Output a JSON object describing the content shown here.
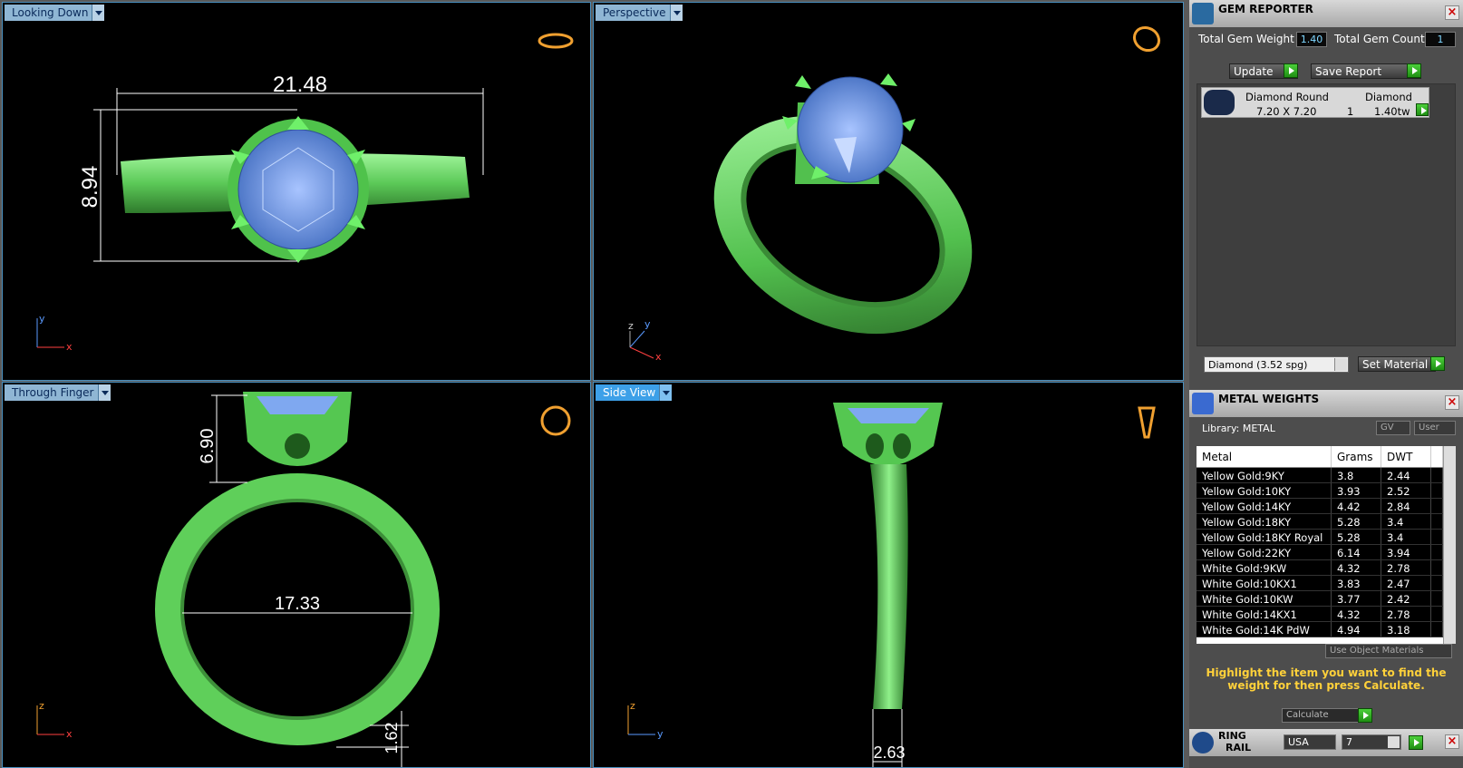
{
  "viewports": {
    "top_left": {
      "label": "Looking Down",
      "dim_width": "21.48",
      "dim_height": "8.94",
      "axis_a": "y",
      "axis_b": "x"
    },
    "top_right": {
      "label": "Perspective",
      "axis_a": "z",
      "axis_b": "y",
      "axis_c": "x"
    },
    "bottom_left": {
      "label": "Through Finger",
      "dim_height": "6.90",
      "dim_inner": "17.33",
      "dim_shank": "1.62",
      "axis_a": "z",
      "axis_b": "x"
    },
    "bottom_right": {
      "label": "Side View",
      "dim_width": "2.63",
      "axis_a": "z",
      "axis_b": "y"
    }
  },
  "gem_reporter": {
    "title": "GEM REPORTER",
    "total_weight_label": "Total Gem Weight",
    "total_weight_value": "1.40",
    "total_count_label": "Total Gem Count",
    "total_count_value": "1",
    "update_label": "Update",
    "save_label": "Save Report",
    "gem": {
      "name": "Diamond Round",
      "type": "Diamond",
      "size": "7.20 X 7.20",
      "count": "1",
      "weight": "1.40tw"
    },
    "material_select": "Diamond   (3.52 spg)",
    "set_material_label": "Set Material"
  },
  "metal_weights": {
    "title": "METAL WEIGHTS",
    "library_label": "Library: METAL",
    "gv_label": "GV",
    "user_label": "User",
    "columns": [
      "Metal",
      "Grams",
      "DWT"
    ],
    "rows": [
      [
        "Yellow Gold:9KY",
        "3.8",
        "2.44"
      ],
      [
        "Yellow Gold:10KY",
        "3.93",
        "2.52"
      ],
      [
        "Yellow Gold:14KY",
        "4.42",
        "2.84"
      ],
      [
        "Yellow Gold:18KY",
        "5.28",
        "3.4"
      ],
      [
        "Yellow Gold:18KY Royal",
        "5.28",
        "3.4"
      ],
      [
        "Yellow Gold:22KY",
        "6.14",
        "3.94"
      ],
      [
        "White Gold:9KW",
        "4.32",
        "2.78"
      ],
      [
        "White Gold:10KX1",
        "3.83",
        "2.47"
      ],
      [
        "White Gold:10KW",
        "3.77",
        "2.42"
      ],
      [
        "White Gold:14KX1",
        "4.32",
        "2.78"
      ],
      [
        "White Gold:14K PdW",
        "4.94",
        "3.18"
      ]
    ],
    "use_object_label": "Use Object Materials",
    "hint": "Highlight the item you want to find the weight for then press Calculate.",
    "calculate_label": "Calculate"
  },
  "ring_rail": {
    "title_line1": "RING",
    "title_line2": "RAIL",
    "region": "USA",
    "size": "7"
  },
  "colors": {
    "metal": "#6fd86a",
    "gem": "#7fa8f0",
    "accent": "#3da0e8"
  }
}
